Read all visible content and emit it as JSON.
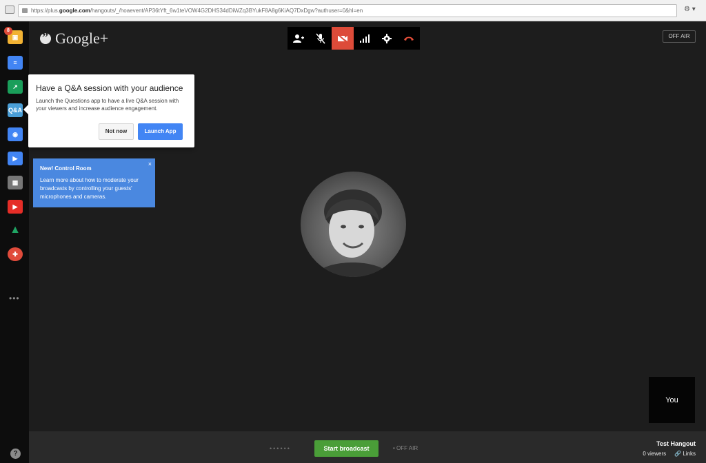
{
  "browser": {
    "url_prefix": "https://plus.",
    "url_domain": "google.com",
    "url_rest": "/hangouts/_/hoaevent/AP36tYft_6w1teVOW4G2DHS34dDiWZq3BYukF8A8g6KiAQ7DxDgw?authuser=0&hl=en"
  },
  "app": {
    "logo": "Google+",
    "off_air": "OFF AIR",
    "avatar_notification": "8"
  },
  "rail": {
    "items": [
      {
        "name": "photo-app",
        "color": "#f2b233",
        "icon": "picture-icon"
      },
      {
        "name": "chat-app",
        "color": "#4285f4",
        "icon": "chat-icon"
      },
      {
        "name": "screenshare-app",
        "color": "#1a9e5a",
        "icon": "screenshare-icon"
      },
      {
        "name": "questions-app",
        "color": "#4a9ed6",
        "icon": "qa-icon",
        "label": "Q&A"
      },
      {
        "name": "capture-app",
        "color": "#4285f4",
        "icon": "camera-icon"
      },
      {
        "name": "control-room-app",
        "color": "#4285f4",
        "icon": "video-control-icon"
      },
      {
        "name": "showcase-app",
        "color": "#777777",
        "icon": "grid-icon"
      },
      {
        "name": "youtube-app",
        "color": "#e52d27",
        "icon": "youtube-icon"
      },
      {
        "name": "drive-app",
        "color": "#1fa463",
        "icon": "drive-icon"
      },
      {
        "name": "help-app",
        "color": "#e04b3b",
        "icon": "lifebuoy-icon"
      }
    ],
    "more": "•••",
    "help": "?"
  },
  "toolbar": {
    "icons": [
      "invite-person-icon",
      "mic-muted-icon",
      "camera-off-icon",
      "bandwidth-icon",
      "settings-icon",
      "hang-up-icon"
    ]
  },
  "qa_popup": {
    "title": "Have a Q&A session with your audience",
    "body": "Launch the Questions app to have a live Q&A session with your viewers and increase audience engagement.",
    "not_now": "Not now",
    "launch": "Launch App"
  },
  "control_tip": {
    "title": "New! Control Room",
    "body": "Learn more about how to moderate your broadcasts by controlling your guests' microphones and cameras.",
    "close": "×"
  },
  "self_view": {
    "label": "You"
  },
  "footer": {
    "dots": "••••••",
    "start": "Start broadcast",
    "off_air": "• OFF AIR",
    "hangout_name": "Test Hangout",
    "viewers": "0 viewers",
    "links": "Links"
  }
}
